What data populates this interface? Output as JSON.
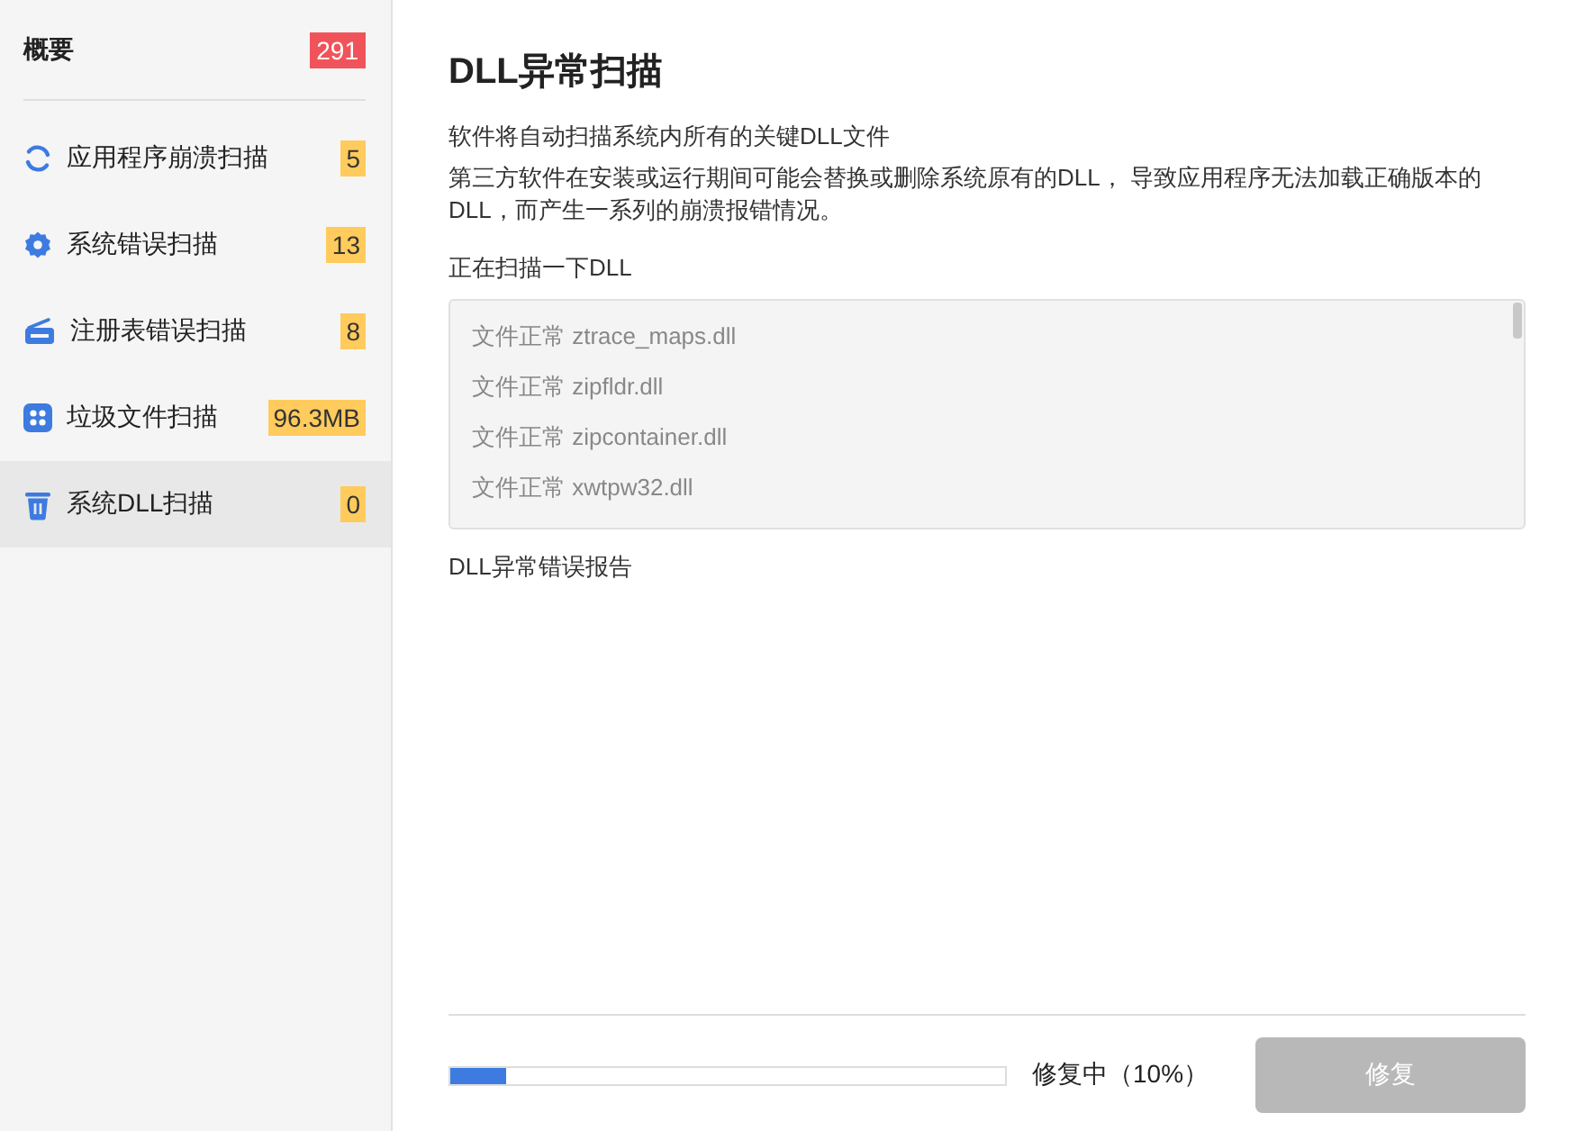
{
  "sidebar": {
    "overview": {
      "label": "概要",
      "count": "291",
      "color": "#f0545a"
    },
    "items": [
      {
        "kind": "refresh",
        "label": "应用程序崩溃扫描",
        "count": "5",
        "color": "#ffcb5c",
        "selected": false
      },
      {
        "kind": "gear",
        "label": "系统错误扫描",
        "count": "13",
        "color": "#ffcb5c",
        "selected": false
      },
      {
        "kind": "radio",
        "label": "注册表错误扫描",
        "count": "8",
        "color": "#ffcb5c",
        "selected": false
      },
      {
        "kind": "apps",
        "label": "垃圾文件扫描",
        "count": "96.3MB",
        "color": "#ffcb5c",
        "selected": false
      },
      {
        "kind": "trash",
        "label": "系统DLL扫描",
        "count": "0",
        "color": "#ffcb5c",
        "selected": true
      }
    ]
  },
  "main": {
    "title": "DLL异常扫描",
    "description": [
      "软件将自动扫描系统内所有的关键DLL文件",
      "第三方软件在安装或运行期间可能会替换或删除系统原有的DLL， 导致应用程序无法加载正确版本的DLL，而产生一系列的崩溃报错情况。"
    ],
    "scan_label": "正在扫描一下DLL",
    "scan_log": [
      {
        "status": "文件正常",
        "file": "ztrace_maps.dll"
      },
      {
        "status": "文件正常",
        "file": "zipfldr.dll"
      },
      {
        "status": "文件正常",
        "file": "zipcontainer.dll"
      },
      {
        "status": "文件正常",
        "file": "xwtpw32.dll"
      }
    ],
    "report_label": "DLL异常错误报告",
    "progress": {
      "level": 0.1,
      "text": "修复中（10%）"
    },
    "button": {
      "label": "修复"
    }
  }
}
